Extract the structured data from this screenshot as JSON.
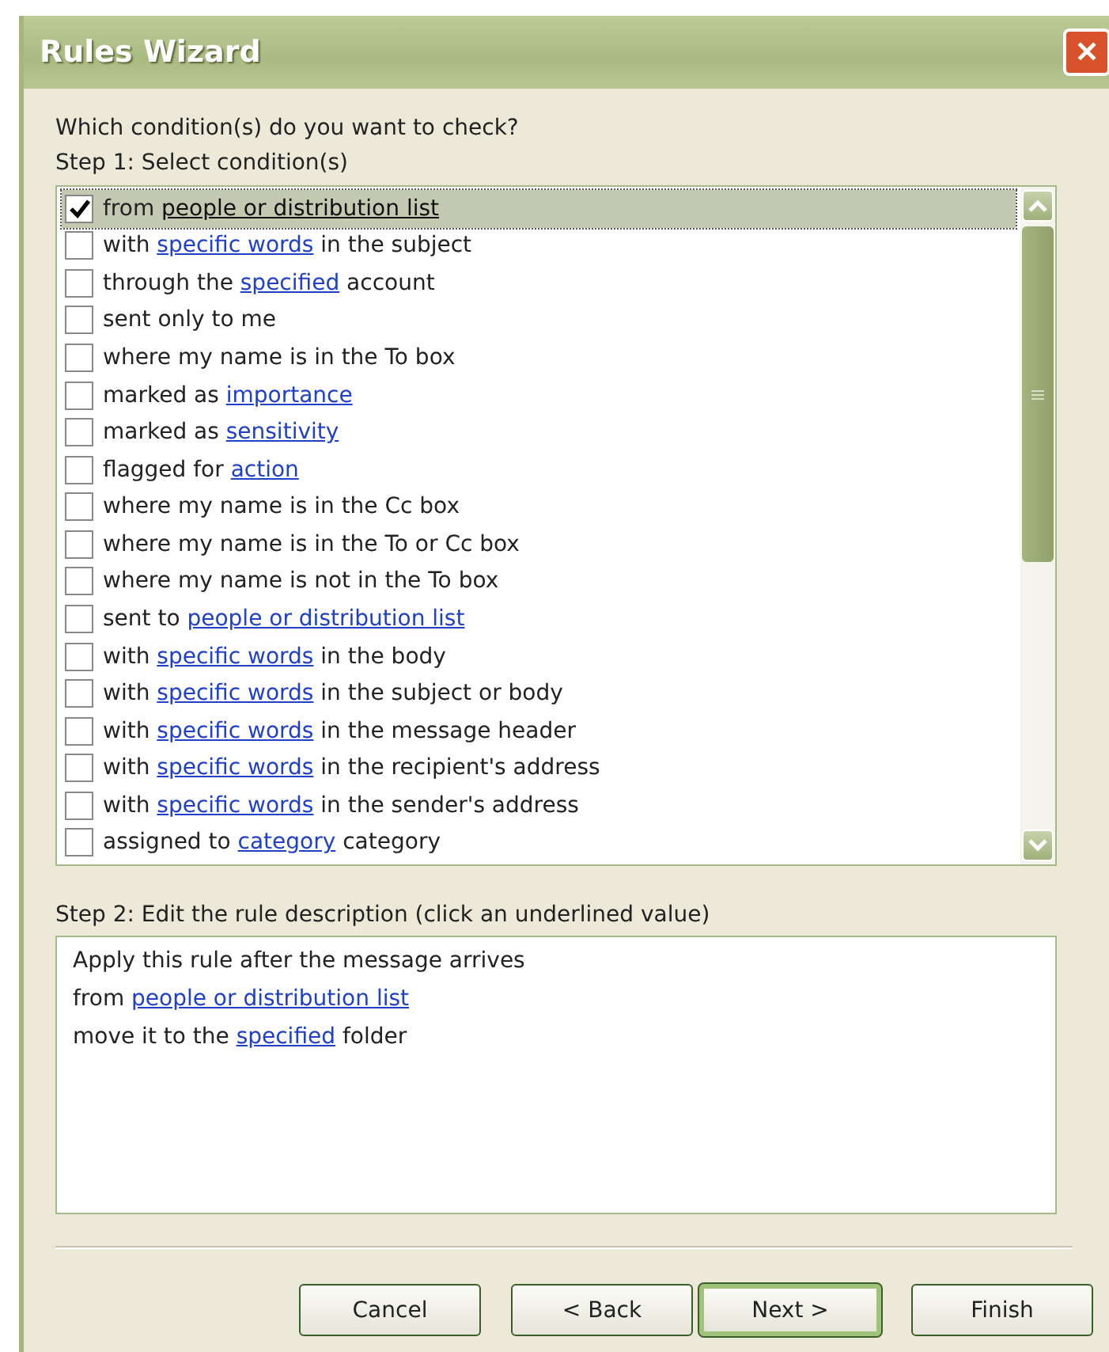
{
  "window": {
    "title": "Rules Wizard",
    "close": "✕"
  },
  "question": "Which condition(s) do you want to check?",
  "step1": {
    "label": "Step 1: Select condition(s)",
    "conditions": [
      {
        "checked": true,
        "selected": true,
        "segments": [
          {
            "text": "from ",
            "link": false
          },
          {
            "text": "people or distribution list",
            "link": true
          }
        ]
      },
      {
        "checked": false,
        "selected": false,
        "segments": [
          {
            "text": "with ",
            "link": false
          },
          {
            "text": "specific words",
            "link": true
          },
          {
            "text": " in the subject",
            "link": false
          }
        ]
      },
      {
        "checked": false,
        "selected": false,
        "segments": [
          {
            "text": "through the ",
            "link": false
          },
          {
            "text": "specified",
            "link": true
          },
          {
            "text": " account",
            "link": false
          }
        ]
      },
      {
        "checked": false,
        "selected": false,
        "segments": [
          {
            "text": "sent only to me",
            "link": false
          }
        ]
      },
      {
        "checked": false,
        "selected": false,
        "segments": [
          {
            "text": "where my name is in the To box",
            "link": false
          }
        ]
      },
      {
        "checked": false,
        "selected": false,
        "segments": [
          {
            "text": "marked as ",
            "link": false
          },
          {
            "text": "importance",
            "link": true
          }
        ]
      },
      {
        "checked": false,
        "selected": false,
        "segments": [
          {
            "text": "marked as ",
            "link": false
          },
          {
            "text": "sensitivity",
            "link": true
          }
        ]
      },
      {
        "checked": false,
        "selected": false,
        "segments": [
          {
            "text": "flagged for ",
            "link": false
          },
          {
            "text": "action",
            "link": true
          }
        ]
      },
      {
        "checked": false,
        "selected": false,
        "segments": [
          {
            "text": "where my name is in the Cc box",
            "link": false
          }
        ]
      },
      {
        "checked": false,
        "selected": false,
        "segments": [
          {
            "text": "where my name is in the To or Cc box",
            "link": false
          }
        ]
      },
      {
        "checked": false,
        "selected": false,
        "segments": [
          {
            "text": "where my name is not in the To box",
            "link": false
          }
        ]
      },
      {
        "checked": false,
        "selected": false,
        "segments": [
          {
            "text": "sent to ",
            "link": false
          },
          {
            "text": "people or distribution list",
            "link": true
          }
        ]
      },
      {
        "checked": false,
        "selected": false,
        "segments": [
          {
            "text": "with ",
            "link": false
          },
          {
            "text": "specific words",
            "link": true
          },
          {
            "text": " in the body",
            "link": false
          }
        ]
      },
      {
        "checked": false,
        "selected": false,
        "segments": [
          {
            "text": "with ",
            "link": false
          },
          {
            "text": "specific words",
            "link": true
          },
          {
            "text": " in the subject or body",
            "link": false
          }
        ]
      },
      {
        "checked": false,
        "selected": false,
        "segments": [
          {
            "text": "with ",
            "link": false
          },
          {
            "text": "specific words",
            "link": true
          },
          {
            "text": " in the message header",
            "link": false
          }
        ]
      },
      {
        "checked": false,
        "selected": false,
        "segments": [
          {
            "text": "with ",
            "link": false
          },
          {
            "text": "specific words",
            "link": true
          },
          {
            "text": " in the recipient's address",
            "link": false
          }
        ]
      },
      {
        "checked": false,
        "selected": false,
        "segments": [
          {
            "text": "with ",
            "link": false
          },
          {
            "text": "specific words",
            "link": true
          },
          {
            "text": " in the sender's address",
            "link": false
          }
        ]
      },
      {
        "checked": false,
        "selected": false,
        "segments": [
          {
            "text": "assigned to ",
            "link": false
          },
          {
            "text": "category",
            "link": true
          },
          {
            "text": " category",
            "link": false
          }
        ]
      }
    ]
  },
  "step2": {
    "label": "Step 2: Edit the rule description (click an underlined value)",
    "lines": [
      [
        {
          "text": "Apply this rule after the message arrives",
          "link": false
        }
      ],
      [
        {
          "text": "from ",
          "link": false
        },
        {
          "text": "people or distribution list",
          "link": true
        }
      ],
      [
        {
          "text": "move it to the ",
          "link": false
        },
        {
          "text": "specified",
          "link": true
        },
        {
          "text": " folder",
          "link": false
        }
      ]
    ]
  },
  "buttons": [
    {
      "label": "Cancel",
      "default": false
    },
    {
      "label": "< Back",
      "default": false
    },
    {
      "label": "Next >",
      "default": true
    },
    {
      "label": "Finish",
      "default": false
    }
  ]
}
